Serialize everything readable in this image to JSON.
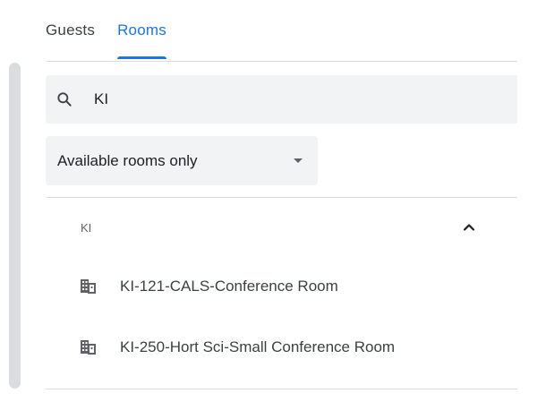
{
  "tabs": [
    {
      "label": "Guests",
      "active": false
    },
    {
      "label": "Rooms",
      "active": true
    }
  ],
  "search": {
    "value": "KI",
    "icon": "search-icon"
  },
  "filter": {
    "selected": "Available rooms only",
    "icon": "caret-down-icon"
  },
  "group": {
    "label": "KI",
    "expanded": true,
    "icon": "chevron-up-icon"
  },
  "rooms": [
    {
      "name": "KI-121-CALS-Conference Room",
      "icon": "building-icon"
    },
    {
      "name": "KI-250-Hort Sci-Small Conference Room",
      "icon": "building-icon"
    }
  ],
  "colors": {
    "accent": "#1a73e8",
    "field_background": "#f1f3f4",
    "divider": "#dadce0",
    "text": "#3c4043",
    "icon": "#5f6368"
  }
}
